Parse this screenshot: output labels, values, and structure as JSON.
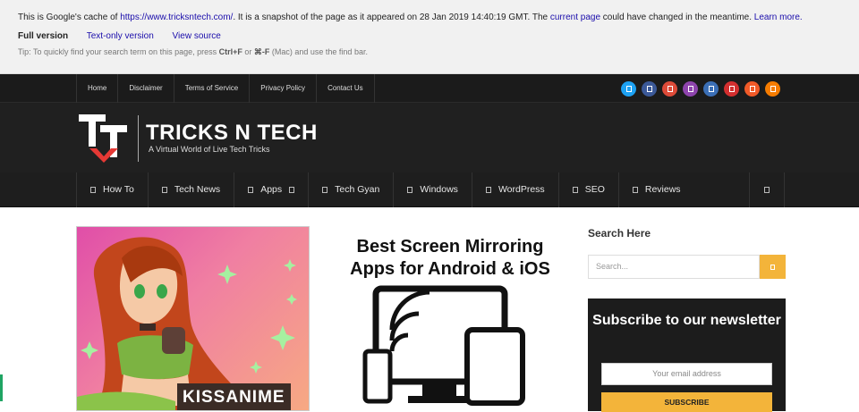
{
  "cache": {
    "prefix": "This is Google's cache of ",
    "url": "https://www.tricksntech.com/",
    "middle": ". It is a snapshot of the page as it appeared on 28 Jan 2019 14:40:19 GMT. The ",
    "current_page": "current page",
    "suffix": " could have changed in the meantime. ",
    "learn_more": "Learn more.",
    "full_version": "Full version",
    "text_only": "Text-only version",
    "view_source": "View source",
    "tip_prefix": "Tip: To quickly find your search term on this page, press ",
    "tip_key1": "Ctrl+F",
    "tip_or": " or ",
    "tip_key2": "⌘-F",
    "tip_suffix": " (Mac) and use the find bar."
  },
  "topmenu": [
    "Home",
    "Disclaimer",
    "Terms of Service",
    "Privacy Policy",
    "Contact Us"
  ],
  "social": [
    {
      "icon": "social-icon-1",
      "color": "#1da1f2"
    },
    {
      "icon": "social-icon-2",
      "color": "#3b5998"
    },
    {
      "icon": "social-icon-3",
      "color": "#dd4b39"
    },
    {
      "icon": "social-icon-4",
      "color": "#8e44ad"
    },
    {
      "icon": "social-icon-5",
      "color": "#3b6fb6"
    },
    {
      "icon": "social-icon-6",
      "color": "#d32f2f"
    },
    {
      "icon": "social-icon-7",
      "color": "#f05a28"
    },
    {
      "icon": "social-icon-8",
      "color": "#f57c00"
    }
  ],
  "logo": {
    "title": "TRICKS N TECH",
    "subtitle": "A Virtual World of Live Tech Tricks"
  },
  "nav": {
    "items": [
      "How To",
      "Tech News",
      "Apps",
      "Tech Gyan",
      "Windows",
      "WordPress",
      "SEO",
      "Reviews"
    ]
  },
  "posts": {
    "kissanime_label": "KISSANIME",
    "mirror_title_1": "Best Screen Mirroring",
    "mirror_title_2": "Apps for Android & iOS"
  },
  "sidebar": {
    "search_title": "Search Here",
    "search_placeholder": "Search...",
    "newsletter_title": "Subscribe to our newsletter",
    "email_placeholder": "Your email address",
    "subscribe_label": "SUBSCRIBE"
  },
  "colors": {
    "accent": "#f3b43a",
    "header_bg": "#202020",
    "logo_red": "#e53935"
  }
}
